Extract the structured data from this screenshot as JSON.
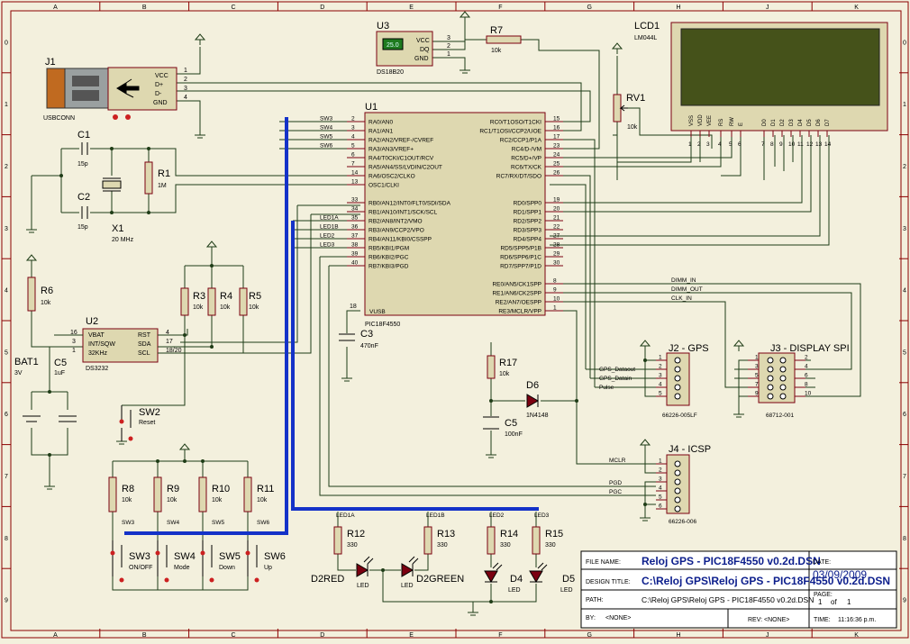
{
  "border": {
    "cols": [
      "A",
      "B",
      "C",
      "D",
      "E",
      "F",
      "G",
      "H",
      "J",
      "K"
    ],
    "rows": [
      "0",
      "1",
      "2",
      "3",
      "4",
      "5",
      "6",
      "7",
      "8",
      "9"
    ]
  },
  "title_block": {
    "file_name_label": "FILE NAME:",
    "file_name": "Reloj GPS - PIC18F4550 v0.2d.DSN",
    "date_label": "DATE:",
    "date": "03/09/2009",
    "design_title_label": "DESIGN TITLE:",
    "design_title": "C:\\Reloj GPS\\Reloj GPS - PIC18F4550 v0.2d.DSN",
    "page_label": "PAGE:",
    "page_num": "1",
    "page_of": "of",
    "page_total": "1",
    "path_label": "PATH:",
    "path": "C:\\Reloj GPS\\Reloj GPS - PIC18F4550 v0.2d.DSN",
    "by_label": "BY:",
    "by": "<NONE>",
    "rev_label": "REV:",
    "rev": "<NONE>",
    "time_label": "TIME:",
    "time": "11:16:36 p.m."
  },
  "components": {
    "j1": {
      "ref": "J1",
      "part": "USBCONN",
      "pins": [
        "VCC",
        "D+",
        "D-",
        "GND"
      ],
      "nums": [
        "1",
        "2",
        "3",
        "4"
      ]
    },
    "u3": {
      "ref": "U3",
      "part": "DS18B20",
      "temp": "25.0",
      "pins": [
        "VCC",
        "DQ",
        "GND"
      ],
      "nums": [
        "3",
        "2",
        "1"
      ]
    },
    "r7": {
      "ref": "R7",
      "value": "10k"
    },
    "lcd1": {
      "ref": "LCD1",
      "part": "LM044L",
      "pins": [
        "VSS",
        "VDD",
        "VEE",
        "RS",
        "RW",
        "E",
        "D0",
        "D1",
        "D2",
        "D3",
        "D4",
        "D5",
        "D6",
        "D7"
      ],
      "nums": [
        "1",
        "2",
        "3",
        "4",
        "5",
        "6",
        "7",
        "8",
        "9",
        "10",
        "11",
        "12",
        "13",
        "14"
      ]
    },
    "rv1": {
      "ref": "RV1",
      "value": "10k"
    },
    "c1": {
      "ref": "C1",
      "value": "15p"
    },
    "c2": {
      "ref": "C2",
      "value": "15p"
    },
    "r1": {
      "ref": "R1",
      "value": "1M"
    },
    "x1": {
      "ref": "X1",
      "value": "20 MHz"
    },
    "u1": {
      "ref": "U1",
      "part": "PIC18F4550",
      "left_pins": [
        {
          "num": "2",
          "name": "RA0/AN0",
          "net": "SW3"
        },
        {
          "num": "3",
          "name": "RA1/AN1",
          "net": "SW4"
        },
        {
          "num": "4",
          "name": "RA2/AN2/VREF-/CVREF",
          "net": "SW5"
        },
        {
          "num": "5",
          "name": "RA3/AN3/VREF+",
          "net": "SW6"
        },
        {
          "num": "6",
          "name": "RA4/T0CKI/C1OUT/RCV",
          "net": ""
        },
        {
          "num": "7",
          "name": "RA5/AN4/SS/LVDIN/C2OUT",
          "net": ""
        },
        {
          "num": "14",
          "name": "RA6/OSC2/CLKO",
          "net": ""
        },
        {
          "num": "13",
          "name": "OSC1/CLKI",
          "net": ""
        },
        {
          "num": "33",
          "name": "RB0/AN12/INT0/FLT0/SDI/SDA",
          "net": ""
        },
        {
          "num": "34",
          "name": "RB1/AN10/INT1/SCK/SCL",
          "net": ""
        },
        {
          "num": "35",
          "name": "RB2/AN8/INT2/VMO",
          "net": "LED1A"
        },
        {
          "num": "36",
          "name": "RB3/AN9/CCP2/VPO",
          "net": "LED1B"
        },
        {
          "num": "37",
          "name": "RB4/AN11/KBI0/CSSPP",
          "net": "LED2"
        },
        {
          "num": "38",
          "name": "RB5/KBI1/PGM",
          "net": "LED3"
        },
        {
          "num": "39",
          "name": "RB6/KBI2/PGC",
          "net": ""
        },
        {
          "num": "40",
          "name": "RB7/KBI3/PGD",
          "net": ""
        }
      ],
      "right_pins": [
        {
          "num": "15",
          "name": "RC0/T1OSO/T1CKI"
        },
        {
          "num": "16",
          "name": "RC1/T1OSI/CCP2/UOE"
        },
        {
          "num": "17",
          "name": "RC2/CCP1/P1A"
        },
        {
          "num": "23",
          "name": "RC4/D-/VM"
        },
        {
          "num": "24",
          "name": "RC5/D+/VP"
        },
        {
          "num": "25",
          "name": "RC6/TX/CK"
        },
        {
          "num": "26",
          "name": "RC7/RX/DT/SDO"
        },
        {
          "num": "19",
          "name": "RD0/SPP0"
        },
        {
          "num": "20",
          "name": "RD1/SPP1"
        },
        {
          "num": "21",
          "name": "RD2/SPP2"
        },
        {
          "num": "22",
          "name": "RD3/SPP3"
        },
        {
          "num": "27",
          "name": "RD4/SPP4"
        },
        {
          "num": "28",
          "name": "RD5/SPP5/P1B"
        },
        {
          "num": "29",
          "name": "RD6/SPP6/P1C"
        },
        {
          "num": "30",
          "name": "RD7/SPP7/P1D"
        },
        {
          "num": "8",
          "name": "RE0/AN5/CK1SPP"
        },
        {
          "num": "9",
          "name": "RE1/AN6/CK2SPP"
        },
        {
          "num": "10",
          "name": "RE2/AN7/OESPP"
        },
        {
          "num": "1",
          "name": "RE3/MCLR/VPP"
        }
      ],
      "vusb_name": "VUSB",
      "vusb_num": "18"
    },
    "c3": {
      "ref": "C3",
      "value": "470nF"
    },
    "r6": {
      "ref": "R6",
      "value": "10k"
    },
    "u2": {
      "ref": "U2",
      "part": "DS3232",
      "left_pins": [
        {
          "num": "16",
          "name": "VBAT"
        },
        {
          "num": "3",
          "name": "INT/SQW"
        },
        {
          "num": "1",
          "name": "32KHz"
        }
      ],
      "right_pins": [
        {
          "num": "4",
          "name": "RST"
        },
        {
          "num": "17",
          "name": "SDA"
        },
        {
          "num": "18/20",
          "name": "SCL"
        }
      ]
    },
    "r3": {
      "ref": "R3",
      "value": "10k"
    },
    "r4": {
      "ref": "R4",
      "value": "10k"
    },
    "r5": {
      "ref": "R5",
      "value": "10k"
    },
    "bat1": {
      "ref": "BAT1",
      "value": "3V"
    },
    "c5a": {
      "ref": "C5",
      "value": "1uF"
    },
    "sw2": {
      "ref": "SW2",
      "label": "Reset"
    },
    "r17": {
      "ref": "R17",
      "value": "10k"
    },
    "d6": {
      "ref": "D6",
      "part": "1N4148"
    },
    "c5b": {
      "ref": "C5",
      "value": "100nF"
    },
    "j2": {
      "ref": "J2 - GPS",
      "part": "66226-005LF",
      "nets": [
        "GPS_Dataout",
        "GPS_Datain",
        "Pulse"
      ],
      "nums": [
        "1",
        "2",
        "3",
        "4",
        "5"
      ]
    },
    "j3": {
      "ref": "J3 - DISPLAY SPI",
      "part": "68712-001",
      "left_nums": [
        "1",
        "3",
        "5",
        "7",
        "9"
      ],
      "right_nums": [
        "2",
        "4",
        "6",
        "8",
        "10"
      ]
    },
    "j4": {
      "ref": "J4 - ICSP",
      "part": "66226-006",
      "nets": [
        "MCLR",
        "PGD",
        "PGC"
      ],
      "nums": [
        "1",
        "2",
        "3",
        "4",
        "5",
        "6"
      ]
    },
    "dimm_nets": [
      "DIMM_IN",
      "DIMM_OUT",
      "CLK_IN"
    ],
    "pull_ups": [
      {
        "ref": "R8",
        "value": "10k",
        "net": "SW3"
      },
      {
        "ref": "R9",
        "value": "10k",
        "net": "SW4"
      },
      {
        "ref": "R10",
        "value": "10k",
        "net": "SW5"
      },
      {
        "ref": "R11",
        "value": "10k",
        "net": "SW6"
      }
    ],
    "switches": [
      {
        "ref": "SW3",
        "label": "ON/OFF"
      },
      {
        "ref": "SW4",
        "label": "Mode"
      },
      {
        "ref": "SW5",
        "label": "Down"
      },
      {
        "ref": "SW6",
        "label": "Up"
      }
    ],
    "leds": [
      {
        "net": "LED1A",
        "rref": "R12",
        "rval": "330",
        "dref": "D2RED",
        "dtype": "LED"
      },
      {
        "net": "LED1B",
        "rref": "R13",
        "rval": "330",
        "dref": "D2GREEN",
        "dtype": "LED"
      },
      {
        "net": "LED2",
        "rref": "R14",
        "rval": "330",
        "dref": "D4",
        "dtype": "LED"
      },
      {
        "net": "LED3",
        "rref": "R15",
        "rval": "330",
        "dref": "D5",
        "dtype": "LED"
      }
    ]
  },
  "colors": {
    "bg": "#f3f0dd",
    "border": "#8b0000",
    "wire": "#1e3c16",
    "bus": "#1432c8",
    "body": "#ded8b0",
    "pin": "#7b0010",
    "text": "#000000",
    "lcd_screen": "#45521a",
    "title_text": "#0c1e8c"
  }
}
